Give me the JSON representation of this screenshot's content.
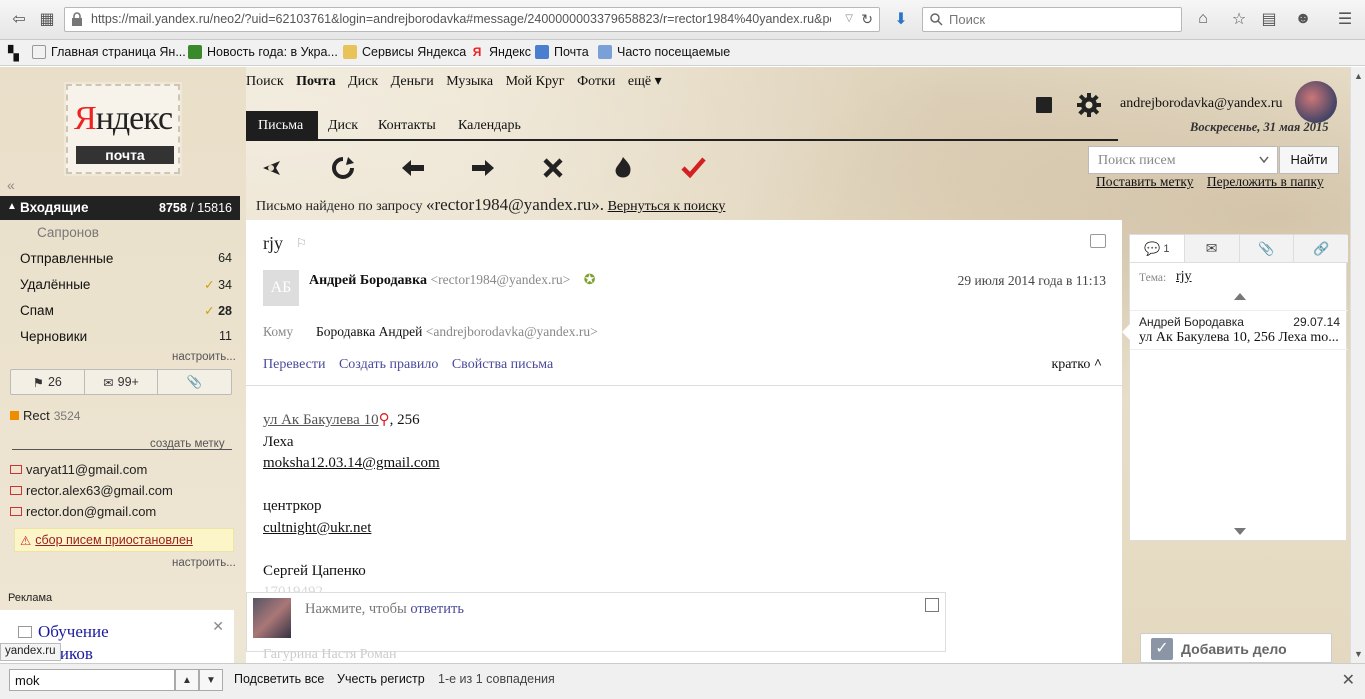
{
  "browser": {
    "url": "https://mail.yandex.ru/neo2/?uid=62103761&login=andrejborodavka#message/2400000003379658823/r=rector1984%40yandex.ru&pos=19&re",
    "search_placeholder": "Поиск",
    "bookmarks": [
      "Главная страница Ян...",
      "Новость года: в Укра...",
      "Сервисы Яндекса",
      "Яндекс",
      "Почта",
      "Часто посещаемые"
    ]
  },
  "logo": {
    "brand_y": "Я",
    "brand_rest": "ндекс",
    "product": "почта"
  },
  "services": {
    "items": [
      "Поиск",
      "Почта",
      "Диск",
      "Деньги",
      "Музыка",
      "Мой Круг",
      "Фотки",
      "ещё ▾"
    ],
    "active": "Почта"
  },
  "mail_tabs": [
    "Письма",
    "Диск",
    "Контакты",
    "Календарь"
  ],
  "user": {
    "email": "andrejborodavka@yandex.ru",
    "date": "Воскресенье, 31 мая 2015"
  },
  "search_mail": {
    "placeholder": "Поиск писем",
    "button": "Найти",
    "links": [
      "Поставить метку",
      "Переложить в папку"
    ]
  },
  "found": {
    "prefix": "Письмо найдено по запросу",
    "query": "«rector1984@yandex.ru».",
    "back": "Вернуться к поиску"
  },
  "folders": {
    "inbox": {
      "label": "Входящие",
      "unread": "8758",
      "total": "15816"
    },
    "sub": "Сапронов",
    "list": [
      {
        "label": "Отправленные",
        "count": "64",
        "check": false,
        "bold": false
      },
      {
        "label": "Удалённые",
        "count": "34",
        "check": true,
        "bold": false
      },
      {
        "label": "Спам",
        "count": "28",
        "check": true,
        "bold": true
      },
      {
        "label": "Черновики",
        "count": "11",
        "check": false,
        "bold": false
      }
    ],
    "configure": "настроить...",
    "flagged": "26",
    "unread_count": "99+"
  },
  "labels": {
    "items": [
      {
        "name": "Rect",
        "count": "3524",
        "color": "#f08c00"
      }
    ],
    "create": "создать метку"
  },
  "collectors": {
    "items": [
      "varyat11@gmail.com",
      "rector.alex63@gmail.com",
      "rector.don@gmail.com"
    ],
    "warning": "сбор писем приостановлен",
    "configure": "настроить..."
  },
  "ad": {
    "label": "Реклама",
    "line1": "Обучение",
    "line2": "...ников"
  },
  "status_url": "yandex.ru",
  "message": {
    "subject": "rjy",
    "avatar_initials": "АБ",
    "sender_name": "Андрей Бородавка",
    "sender_email": "<rector1984@yandex.ru>",
    "date": "29 июля 2014 года в 11:13",
    "to_label": "Кому",
    "to_name": "Бородавка Андрей",
    "to_email": "<andrejborodavka@yandex.ru>",
    "links": [
      "Перевести",
      "Создать правило",
      "Свойства письма"
    ],
    "brief": "кратко",
    "body": {
      "address": "ул Ак Бакулева 10",
      "address_rest": ", 256",
      "l2": "Леха",
      "l3": "moksha12.03.14@gmail.com",
      "l4": "центркор",
      "l5": "cultnight@ukr.net",
      "l6": "Сергей Цапенко",
      "l7": "17019492"
    },
    "reply_prefix": "Нажмите, чтобы ",
    "reply_link": "ответить",
    "ghost": "Гагурина Настя Роман"
  },
  "thread": {
    "tab_count": "1",
    "theme_label": "Тема:",
    "theme_value": "rjy",
    "item": {
      "from": "Андрей Бородавка",
      "date": "29.07.14",
      "snippet": "ул Ак Бакулева 10, 256 Леха mo..."
    }
  },
  "todo": "Добавить дело",
  "findbar": {
    "query": "mok",
    "highlight_all": "Подсветить все",
    "match_case": "Учесть регистр",
    "result": "1-е из 1 совпадения"
  }
}
